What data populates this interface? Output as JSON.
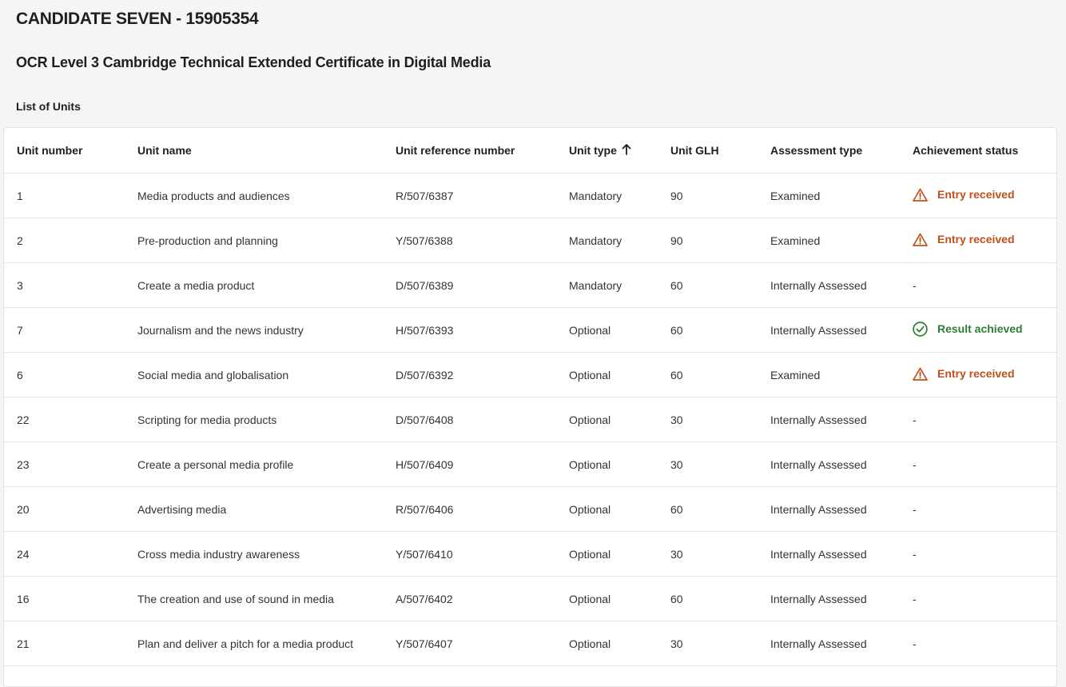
{
  "candidate": {
    "title": "CANDIDATE SEVEN - 15905354"
  },
  "qualification": {
    "title": "OCR Level 3 Cambridge Technical Extended Certificate in Digital Media"
  },
  "units_section": {
    "title": "List of Units"
  },
  "table": {
    "headers": {
      "unit_number": "Unit number",
      "unit_name": "Unit name",
      "unit_ref": "Unit reference number",
      "unit_type": "Unit type",
      "unit_glh": "Unit GLH",
      "assessment_type": "Assessment type",
      "achievement_status": "Achievement status"
    },
    "sort": {
      "column": "unit_type",
      "direction": "ascending",
      "icon": "arrow-up-icon"
    },
    "status_colors": {
      "warning": "#c0501a",
      "success": "#2e7d32"
    },
    "rows": [
      {
        "number": "1",
        "name": "Media products and audiences",
        "ref": "R/507/6387",
        "type": "Mandatory",
        "glh": "90",
        "assessment": "Examined",
        "status": "Entry received",
        "status_kind": "warning",
        "status_icon": "warning-triangle-icon"
      },
      {
        "number": "2",
        "name": "Pre-production and planning",
        "ref": "Y/507/6388",
        "type": "Mandatory",
        "glh": "90",
        "assessment": "Examined",
        "status": "Entry received",
        "status_kind": "warning",
        "status_icon": "warning-triangle-icon"
      },
      {
        "number": "3",
        "name": "Create a media product",
        "ref": "D/507/6389",
        "type": "Mandatory",
        "glh": "60",
        "assessment": "Internally Assessed",
        "status": "-",
        "status_kind": "none",
        "status_icon": ""
      },
      {
        "number": "7",
        "name": "Journalism and the news industry",
        "ref": "H/507/6393",
        "type": "Optional",
        "glh": "60",
        "assessment": "Internally Assessed",
        "status": "Result achieved",
        "status_kind": "success",
        "status_icon": "check-circle-icon"
      },
      {
        "number": "6",
        "name": "Social media and globalisation",
        "ref": "D/507/6392",
        "type": "Optional",
        "glh": "60",
        "assessment": "Examined",
        "status": "Entry received",
        "status_kind": "warning",
        "status_icon": "warning-triangle-icon"
      },
      {
        "number": "22",
        "name": "Scripting for media products",
        "ref": "D/507/6408",
        "type": "Optional",
        "glh": "30",
        "assessment": "Internally Assessed",
        "status": "-",
        "status_kind": "none",
        "status_icon": ""
      },
      {
        "number": "23",
        "name": "Create a personal media profile",
        "ref": "H/507/6409",
        "type": "Optional",
        "glh": "30",
        "assessment": "Internally Assessed",
        "status": "-",
        "status_kind": "none",
        "status_icon": ""
      },
      {
        "number": "20",
        "name": "Advertising media",
        "ref": "R/507/6406",
        "type": "Optional",
        "glh": "60",
        "assessment": "Internally Assessed",
        "status": "-",
        "status_kind": "none",
        "status_icon": ""
      },
      {
        "number": "24",
        "name": "Cross media industry awareness",
        "ref": "Y/507/6410",
        "type": "Optional",
        "glh": "30",
        "assessment": "Internally Assessed",
        "status": "-",
        "status_kind": "none",
        "status_icon": ""
      },
      {
        "number": "16",
        "name": "The creation and use of sound in media",
        "ref": "A/507/6402",
        "type": "Optional",
        "glh": "60",
        "assessment": "Internally Assessed",
        "status": "-",
        "status_kind": "none",
        "status_icon": ""
      },
      {
        "number": "21",
        "name": "Plan and deliver a pitch for a media product",
        "ref": "Y/507/6407",
        "type": "Optional",
        "glh": "30",
        "assessment": "Internally Assessed",
        "status": "-",
        "status_kind": "none",
        "status_icon": ""
      }
    ]
  }
}
